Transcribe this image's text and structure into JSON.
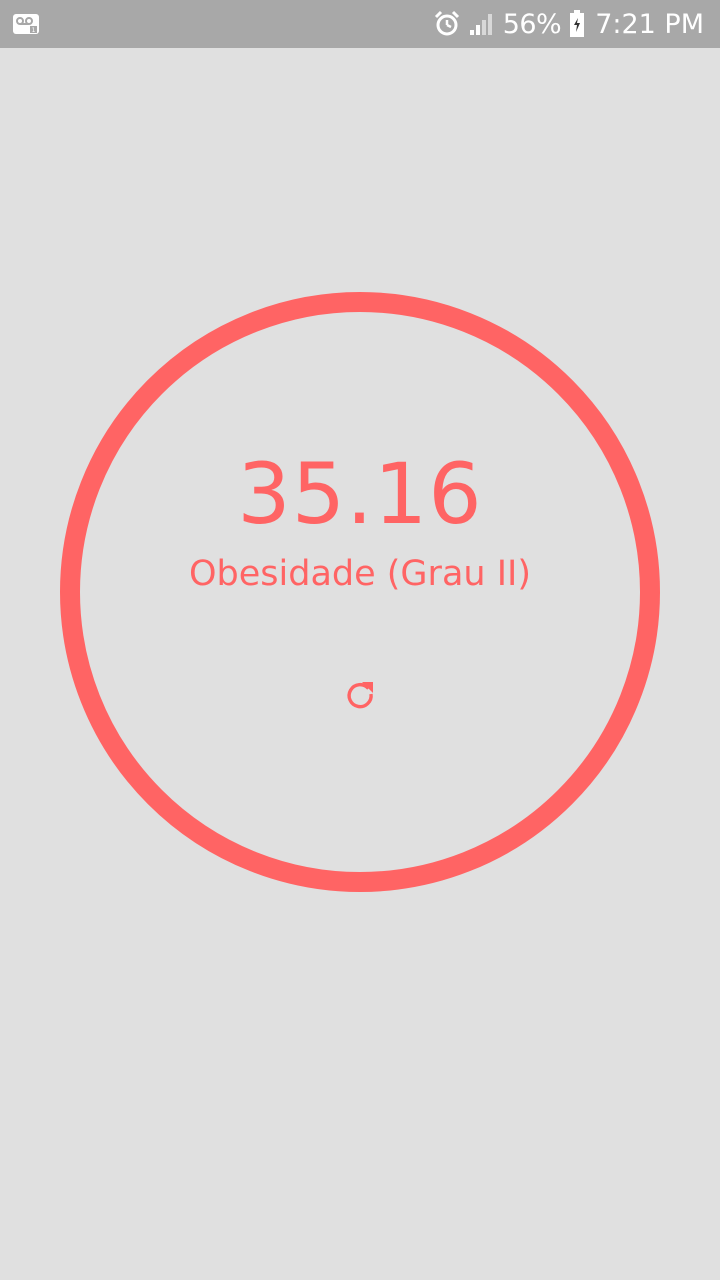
{
  "status_bar": {
    "battery_percent": "56%",
    "time": "7:21 PM",
    "icons": [
      "voicemail-icon",
      "alarm-icon",
      "signal-icon",
      "battery-icon"
    ]
  },
  "result": {
    "value": "35.16",
    "category": "Obesidade (Grau II)",
    "refresh_icon": "refresh-icon"
  },
  "colors": {
    "accent": "#ff6464",
    "background": "#e0e0e0",
    "status_bar": "#a8a8a8"
  }
}
